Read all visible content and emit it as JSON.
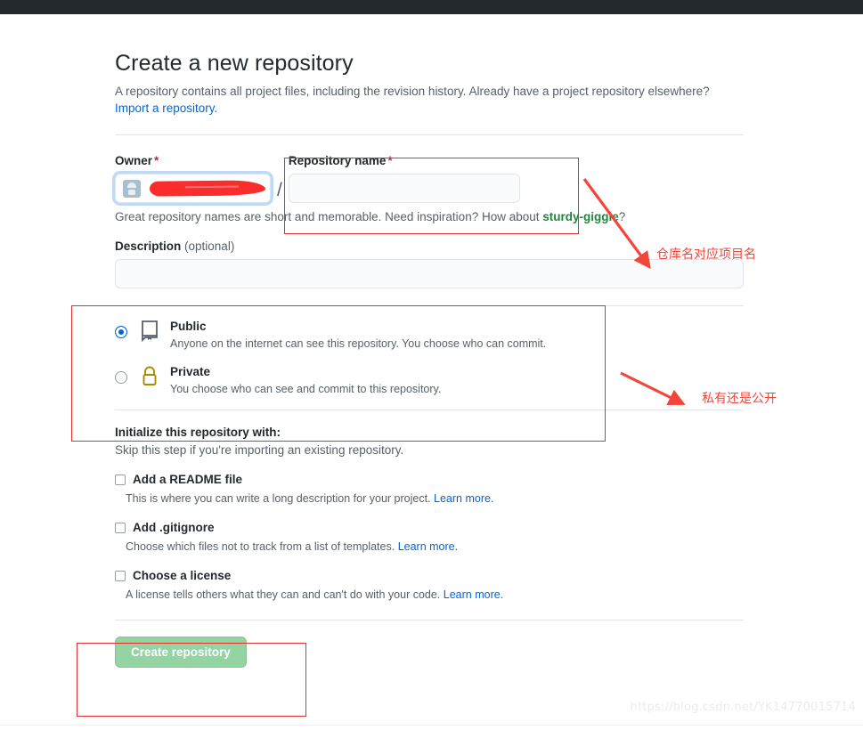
{
  "page": {
    "title": "Create a new repository",
    "subtitle_text": "A repository contains all project files, including the revision history. Already have a project repository elsewhere?",
    "import_link": "Import a repository."
  },
  "owner": {
    "label": "Owner",
    "required_mark": "*",
    "value": "",
    "avatar_icon": "user-avatar-icon",
    "separator": "/"
  },
  "repo_name": {
    "label": "Repository name",
    "required_mark": "*",
    "value": "",
    "placeholder": ""
  },
  "hint": {
    "prefix": "Great repository names are short and memorable. Need inspiration? How about ",
    "suggestion": "sturdy-giggle",
    "suffix": "?"
  },
  "description": {
    "label": "Description",
    "optional_note": "(optional)",
    "value": "",
    "placeholder": ""
  },
  "visibility": {
    "options": [
      {
        "id": "public",
        "title": "Public",
        "desc": "Anyone on the internet can see this repository. You choose who can commit.",
        "icon": "repo-book-icon",
        "selected": true
      },
      {
        "id": "private",
        "title": "Private",
        "desc": "You choose who can see and commit to this repository.",
        "icon": "lock-icon",
        "selected": false
      }
    ]
  },
  "initialize": {
    "title": "Initialize this repository with:",
    "subtitle": "Skip this step if you're importing an existing repository.",
    "items": [
      {
        "label": "Add a README file",
        "desc": "This is where you can write a long description for your project.",
        "link": "Learn more.",
        "checked": false
      },
      {
        "label": "Add .gitignore",
        "desc": "Choose which files not to track from a list of templates.",
        "link": "Learn more.",
        "checked": false
      },
      {
        "label": "Choose a license",
        "desc": "A license tells others what they can and can't do with your code.",
        "link": "Learn more.",
        "checked": false
      }
    ]
  },
  "submit": {
    "label": "Create repository",
    "disabled": true,
    "color": "#94d3a2"
  },
  "annotations": {
    "accent_color": "#f4453c",
    "box_color": "#e03030",
    "labels": [
      {
        "text": "仓库名对应项目名"
      },
      {
        "text": "私有还是公开"
      }
    ]
  },
  "watermark": "https://blog.csdn.net/YK14770015714"
}
